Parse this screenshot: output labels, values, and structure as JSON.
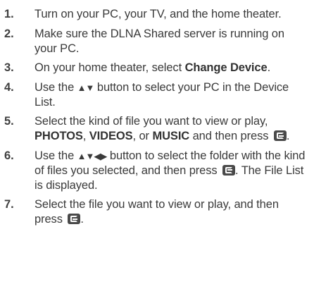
{
  "steps": [
    {
      "num": "1.",
      "text": "Turn on your PC, your TV, and the home theater."
    },
    {
      "num": "2.",
      "text": "Make sure the DLNA Shared server is running on your PC."
    },
    {
      "num": "3.",
      "pre": "On your home theater, select ",
      "kw": "Change Device",
      "post": "."
    },
    {
      "num": "4.",
      "pre": "Use the ",
      "arrows": "▲▼",
      "post": " button to select your PC in the Device List."
    },
    {
      "num": "5.",
      "pre": "Select the kind of file you want to view or play, ",
      "kw1": "PHOTOS",
      "sep1": ", ",
      "kw2": "VIDEOS",
      "sep2": ", or ",
      "kw3": "MUSIC",
      "post": " and then press ",
      "end": "."
    },
    {
      "num": "6.",
      "pre": "Use the ",
      "arrows": "▲▼◀▶",
      "mid": " button to select the folder with the kind of files you selected, and then press ",
      "post": ". The File List is displayed."
    },
    {
      "num": "7.",
      "pre": "Select the file you want to view or play, and then press ",
      "end": "."
    }
  ],
  "icons": {
    "enter_button": "enter-button-icon"
  }
}
